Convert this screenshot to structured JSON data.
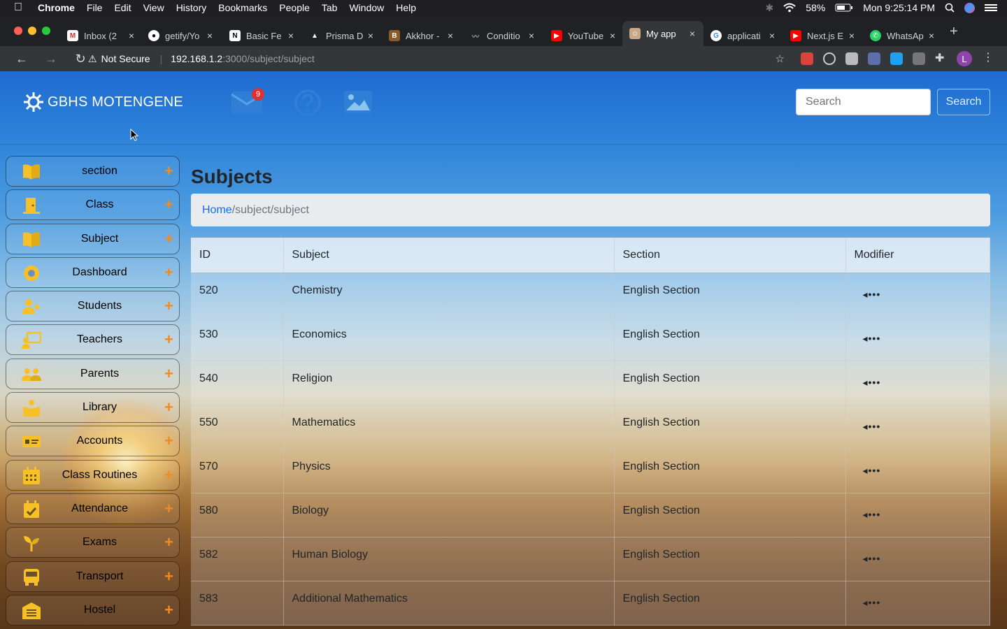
{
  "menubar": {
    "app_name": "Chrome",
    "items": [
      "File",
      "Edit",
      "View",
      "History",
      "Bookmarks",
      "People",
      "Tab",
      "Window",
      "Help"
    ],
    "battery": "58%",
    "clock": "Mon 9:25:14 PM"
  },
  "tabs": [
    {
      "title": "Inbox (2",
      "color": "#d93025"
    },
    {
      "title": "getify/Yo",
      "color": "#333333"
    },
    {
      "title": "Basic Fe",
      "color": "#000000"
    },
    {
      "title": "Prisma D",
      "color": "#0c344b"
    },
    {
      "title": "Akkhor -",
      "color": "#8a5a2b"
    },
    {
      "title": "Conditio",
      "color": "#555555"
    },
    {
      "title": "YouTube",
      "color": "#ff0000"
    },
    {
      "title": "My app",
      "color": "#c9a98a"
    },
    {
      "title": "applicati",
      "color": "#4285f4"
    },
    {
      "title": "Next.js E",
      "color": "#ff0000"
    },
    {
      "title": "WhatsAp",
      "color": "#25d366"
    }
  ],
  "toolbar": {
    "security_label": "Not Secure",
    "url_host": "192.168.1.2",
    "url_path": ":3000/subject/subject",
    "profile_initial": "L"
  },
  "header": {
    "brand": "GBHS MOTENGENE",
    "mail_badge": "9",
    "search_placeholder": "Search",
    "search_button": "Search"
  },
  "sidebar": {
    "items": [
      {
        "label": "section",
        "icon": "book-open-icon",
        "color": "#f6c026"
      },
      {
        "label": "Class",
        "icon": "door-icon",
        "color": "#f6c026"
      },
      {
        "label": "Subject",
        "icon": "book-open-icon",
        "color": "#f6c026"
      },
      {
        "label": "Dashboard",
        "icon": "lifebuoy-icon",
        "color": "#f6c026"
      },
      {
        "label": "Students",
        "icon": "user-plus-icon",
        "color": "#f6c026"
      },
      {
        "label": "Teachers",
        "icon": "chalkboard-teacher-icon",
        "color": "#f6c026"
      },
      {
        "label": "Parents",
        "icon": "users-icon",
        "color": "#f6c026"
      },
      {
        "label": "Library",
        "icon": "book-reader-icon",
        "color": "#f6c026"
      },
      {
        "label": "Accounts",
        "icon": "money-card-icon",
        "color": "#f6c026"
      },
      {
        "label": "Class Routines",
        "icon": "calendar-icon",
        "color": "#f6c026"
      },
      {
        "label": "Attendance",
        "icon": "calendar-check-icon",
        "color": "#f6c026"
      },
      {
        "label": "Exams",
        "icon": "seedling-icon",
        "color": "#f6c026"
      },
      {
        "label": "Transport",
        "icon": "bus-icon",
        "color": "#f6c026"
      },
      {
        "label": "Hostel",
        "icon": "warehouse-icon",
        "color": "#f6c026"
      }
    ]
  },
  "main": {
    "title": "Subjects",
    "breadcrumb_home": "Home",
    "breadcrumb_rest": "/subject/subject",
    "columns": [
      "ID",
      "Subject",
      "Section",
      "Modifier"
    ],
    "rows": [
      {
        "id": "520",
        "subject": "Chemistry",
        "section": "English Section"
      },
      {
        "id": "530",
        "subject": "Economics",
        "section": "English Section"
      },
      {
        "id": "540",
        "subject": "Religion",
        "section": "English Section"
      },
      {
        "id": "550",
        "subject": "Mathematics",
        "section": "English Section"
      },
      {
        "id": "570",
        "subject": "Physics",
        "section": "English Section"
      },
      {
        "id": "580",
        "subject": "Biology",
        "section": "English Section"
      },
      {
        "id": "582",
        "subject": "Human Biology",
        "section": "English Section"
      },
      {
        "id": "583",
        "subject": "Additional Mathematics",
        "section": "English Section"
      }
    ]
  }
}
